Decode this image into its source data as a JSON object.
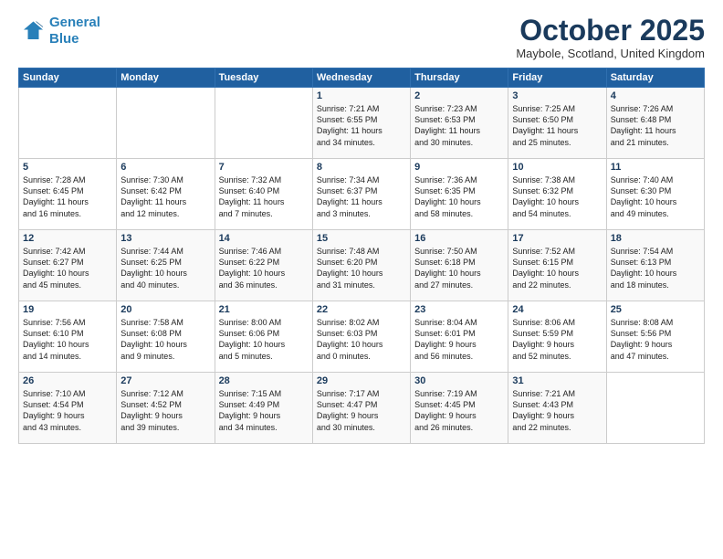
{
  "logo": {
    "line1": "General",
    "line2": "Blue"
  },
  "title": "October 2025",
  "location": "Maybole, Scotland, United Kingdom",
  "days_header": [
    "Sunday",
    "Monday",
    "Tuesday",
    "Wednesday",
    "Thursday",
    "Friday",
    "Saturday"
  ],
  "weeks": [
    [
      {
        "num": "",
        "info": ""
      },
      {
        "num": "",
        "info": ""
      },
      {
        "num": "",
        "info": ""
      },
      {
        "num": "1",
        "info": "Sunrise: 7:21 AM\nSunset: 6:55 PM\nDaylight: 11 hours\nand 34 minutes."
      },
      {
        "num": "2",
        "info": "Sunrise: 7:23 AM\nSunset: 6:53 PM\nDaylight: 11 hours\nand 30 minutes."
      },
      {
        "num": "3",
        "info": "Sunrise: 7:25 AM\nSunset: 6:50 PM\nDaylight: 11 hours\nand 25 minutes."
      },
      {
        "num": "4",
        "info": "Sunrise: 7:26 AM\nSunset: 6:48 PM\nDaylight: 11 hours\nand 21 minutes."
      }
    ],
    [
      {
        "num": "5",
        "info": "Sunrise: 7:28 AM\nSunset: 6:45 PM\nDaylight: 11 hours\nand 16 minutes."
      },
      {
        "num": "6",
        "info": "Sunrise: 7:30 AM\nSunset: 6:42 PM\nDaylight: 11 hours\nand 12 minutes."
      },
      {
        "num": "7",
        "info": "Sunrise: 7:32 AM\nSunset: 6:40 PM\nDaylight: 11 hours\nand 7 minutes."
      },
      {
        "num": "8",
        "info": "Sunrise: 7:34 AM\nSunset: 6:37 PM\nDaylight: 11 hours\nand 3 minutes."
      },
      {
        "num": "9",
        "info": "Sunrise: 7:36 AM\nSunset: 6:35 PM\nDaylight: 10 hours\nand 58 minutes."
      },
      {
        "num": "10",
        "info": "Sunrise: 7:38 AM\nSunset: 6:32 PM\nDaylight: 10 hours\nand 54 minutes."
      },
      {
        "num": "11",
        "info": "Sunrise: 7:40 AM\nSunset: 6:30 PM\nDaylight: 10 hours\nand 49 minutes."
      }
    ],
    [
      {
        "num": "12",
        "info": "Sunrise: 7:42 AM\nSunset: 6:27 PM\nDaylight: 10 hours\nand 45 minutes."
      },
      {
        "num": "13",
        "info": "Sunrise: 7:44 AM\nSunset: 6:25 PM\nDaylight: 10 hours\nand 40 minutes."
      },
      {
        "num": "14",
        "info": "Sunrise: 7:46 AM\nSunset: 6:22 PM\nDaylight: 10 hours\nand 36 minutes."
      },
      {
        "num": "15",
        "info": "Sunrise: 7:48 AM\nSunset: 6:20 PM\nDaylight: 10 hours\nand 31 minutes."
      },
      {
        "num": "16",
        "info": "Sunrise: 7:50 AM\nSunset: 6:18 PM\nDaylight: 10 hours\nand 27 minutes."
      },
      {
        "num": "17",
        "info": "Sunrise: 7:52 AM\nSunset: 6:15 PM\nDaylight: 10 hours\nand 22 minutes."
      },
      {
        "num": "18",
        "info": "Sunrise: 7:54 AM\nSunset: 6:13 PM\nDaylight: 10 hours\nand 18 minutes."
      }
    ],
    [
      {
        "num": "19",
        "info": "Sunrise: 7:56 AM\nSunset: 6:10 PM\nDaylight: 10 hours\nand 14 minutes."
      },
      {
        "num": "20",
        "info": "Sunrise: 7:58 AM\nSunset: 6:08 PM\nDaylight: 10 hours\nand 9 minutes."
      },
      {
        "num": "21",
        "info": "Sunrise: 8:00 AM\nSunset: 6:06 PM\nDaylight: 10 hours\nand 5 minutes."
      },
      {
        "num": "22",
        "info": "Sunrise: 8:02 AM\nSunset: 6:03 PM\nDaylight: 10 hours\nand 0 minutes."
      },
      {
        "num": "23",
        "info": "Sunrise: 8:04 AM\nSunset: 6:01 PM\nDaylight: 9 hours\nand 56 minutes."
      },
      {
        "num": "24",
        "info": "Sunrise: 8:06 AM\nSunset: 5:59 PM\nDaylight: 9 hours\nand 52 minutes."
      },
      {
        "num": "25",
        "info": "Sunrise: 8:08 AM\nSunset: 5:56 PM\nDaylight: 9 hours\nand 47 minutes."
      }
    ],
    [
      {
        "num": "26",
        "info": "Sunrise: 7:10 AM\nSunset: 4:54 PM\nDaylight: 9 hours\nand 43 minutes."
      },
      {
        "num": "27",
        "info": "Sunrise: 7:12 AM\nSunset: 4:52 PM\nDaylight: 9 hours\nand 39 minutes."
      },
      {
        "num": "28",
        "info": "Sunrise: 7:15 AM\nSunset: 4:49 PM\nDaylight: 9 hours\nand 34 minutes."
      },
      {
        "num": "29",
        "info": "Sunrise: 7:17 AM\nSunset: 4:47 PM\nDaylight: 9 hours\nand 30 minutes."
      },
      {
        "num": "30",
        "info": "Sunrise: 7:19 AM\nSunset: 4:45 PM\nDaylight: 9 hours\nand 26 minutes."
      },
      {
        "num": "31",
        "info": "Sunrise: 7:21 AM\nSunset: 4:43 PM\nDaylight: 9 hours\nand 22 minutes."
      },
      {
        "num": "",
        "info": ""
      }
    ]
  ]
}
